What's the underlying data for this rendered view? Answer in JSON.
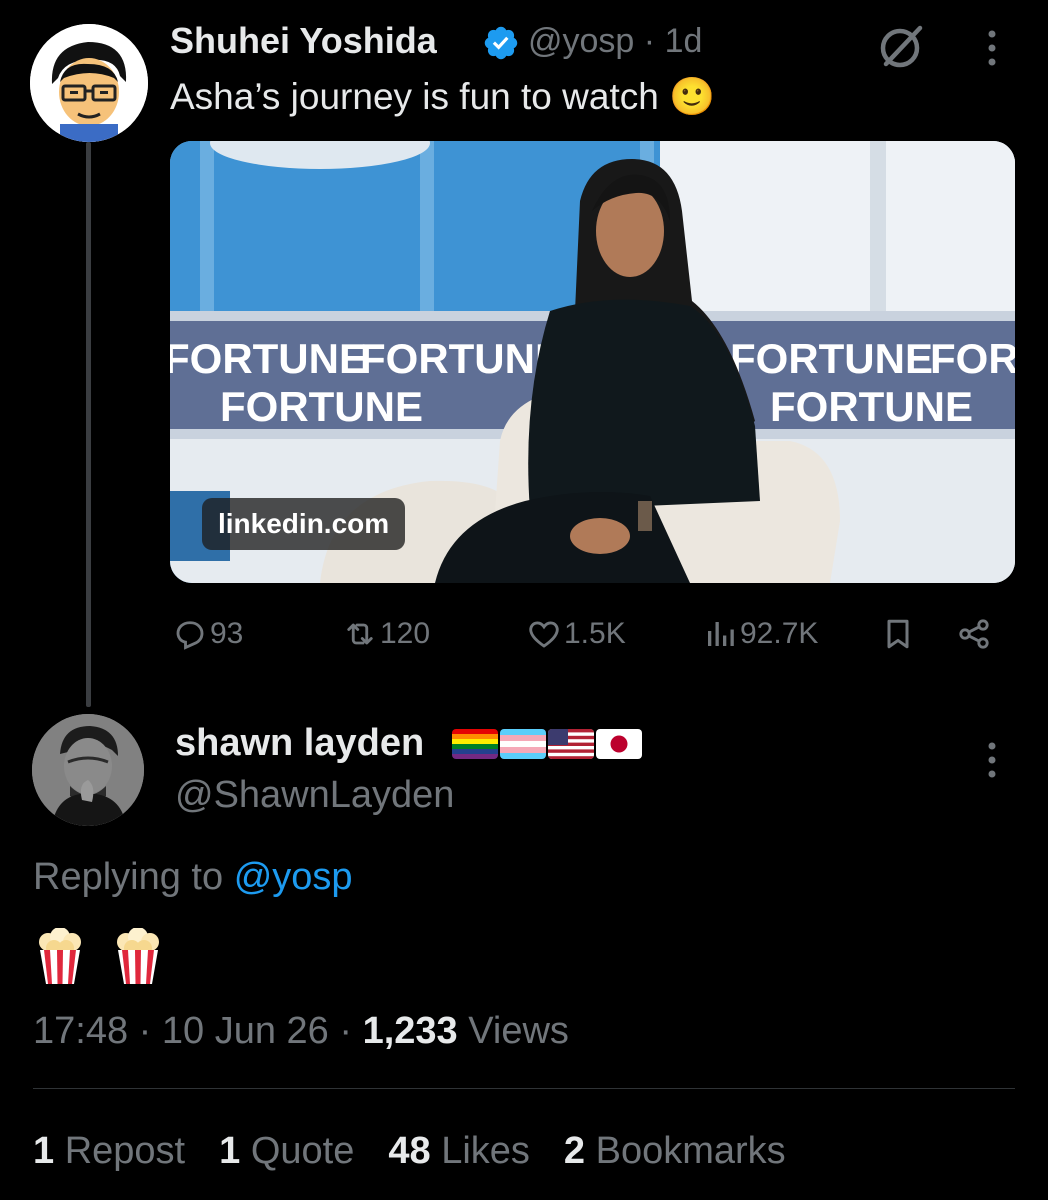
{
  "parent_tweet": {
    "author_name": "Shuhei Yoshida",
    "handle": "@yosp",
    "separator": "·",
    "age": "1d",
    "text": "Asha’s journey is fun to watch",
    "emoji": "🙂",
    "link_card": {
      "domain": "linkedin.com",
      "banner_text": "FORTUNE"
    },
    "actions": {
      "replies": "93",
      "reposts": "120",
      "likes": "1.5K",
      "views": "92.7K"
    }
  },
  "reply_tweet": {
    "author_name": "shawn layden",
    "handle": "@ShawnLayden",
    "replying_prefix": "Replying to",
    "replying_to": "@yosp",
    "text_emoji": "🍿 🍿",
    "time": "17:48",
    "date": "10 Jun 26",
    "dot": "·",
    "views_count": "1,233",
    "views_label": "Views"
  },
  "engagement": [
    {
      "count": "1",
      "label": "Repost"
    },
    {
      "count": "1",
      "label": "Quote"
    },
    {
      "count": "48",
      "label": "Likes"
    },
    {
      "count": "2",
      "label": "Bookmarks"
    }
  ],
  "colors": {
    "background": "#000000",
    "primary_text": "#e7e9ea",
    "secondary_text": "#71767b",
    "link": "#1d9bf0",
    "verified": "#1d9bf0"
  }
}
